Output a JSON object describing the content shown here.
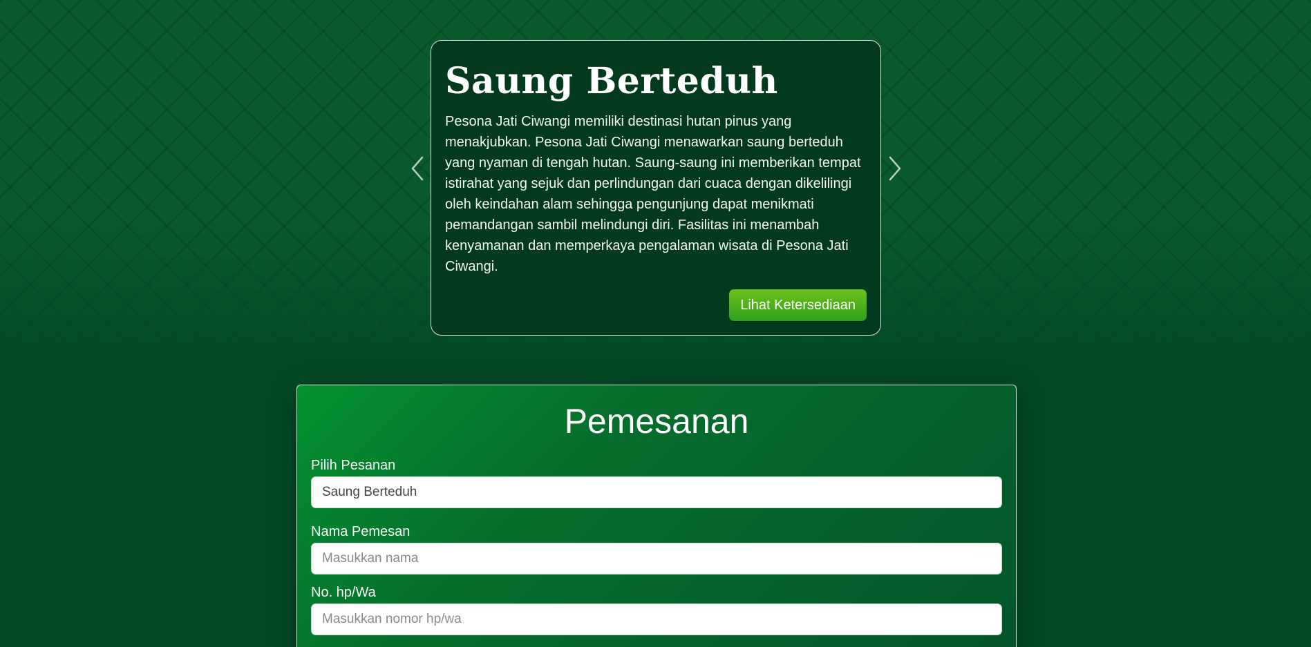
{
  "carousel": {
    "title": "Saung Berteduh",
    "description": "Pesona Jati Ciwangi memiliki destinasi hutan pinus yang menakjubkan. Pesona Jati Ciwangi menawarkan saung berteduh yang nyaman di tengah hutan. Saung-saung ini memberikan tempat istirahat yang sejuk dan perlindungan dari cuaca dengan dikelilingi oleh keindahan alam sehingga pengunjung dapat menikmati pemandangan sambil melindungi diri. Fasilitas ini menambah kenyamanan dan memperkaya pengalaman wisata di Pesona Jati Ciwangi.",
    "button_label": "Lihat Ketersediaan",
    "prev_icon": "chevron-left-icon",
    "next_icon": "chevron-right-icon"
  },
  "form": {
    "title": "Pemesanan",
    "fields": [
      {
        "label": "Pilih Pesanan",
        "value": "Saung Berteduh",
        "placeholder": ""
      },
      {
        "label": "Nama Pemesan",
        "value": "",
        "placeholder": "Masukkan nama"
      },
      {
        "label": "No. hp/Wa",
        "value": "",
        "placeholder": "Masukkan nomor hp/wa"
      }
    ]
  },
  "colors": {
    "background": "#044a26",
    "card": "#03371c",
    "accent_button": "#4fb11b",
    "form_gradient_start": "#04912f",
    "form_gradient_end": "#04542a"
  }
}
